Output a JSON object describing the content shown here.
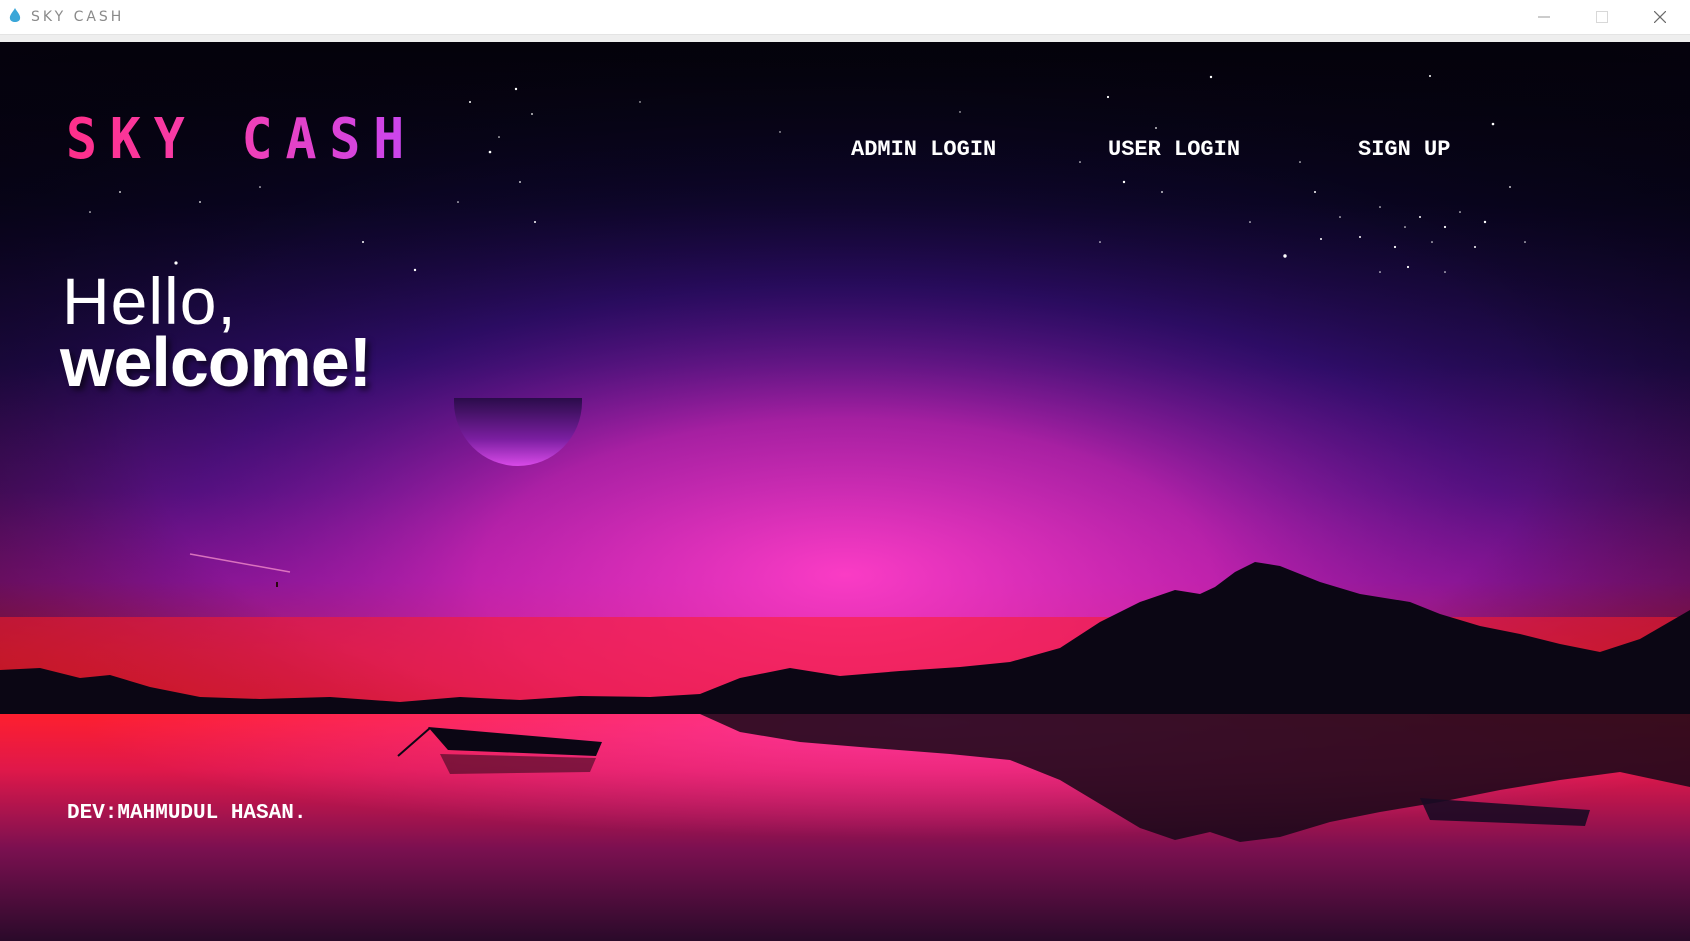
{
  "window": {
    "title": "SKY CASH",
    "icon": "app-drop-icon",
    "controls": [
      "minimize-icon",
      "maximize-icon",
      "close-icon"
    ]
  },
  "brand": {
    "logo_text": "SKY CASH"
  },
  "nav": {
    "admin_login": "ADMIN LOGIN",
    "user_login": "USER LOGIN",
    "sign_up": "SIGN UP"
  },
  "hero": {
    "greeting": "Hello,",
    "headline": "welcome!"
  },
  "footer": {
    "credit": "DEV:MAHMUDUL HASAN."
  },
  "colors": {
    "logo_start": "#ff2f8a",
    "logo_end": "#c846f2",
    "sky_top": "#06030f",
    "horizon_red": "#ff1f2a",
    "sky_magenta": "#f030c0"
  }
}
